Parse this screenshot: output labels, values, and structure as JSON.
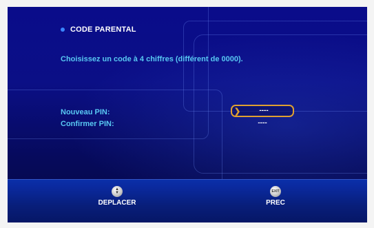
{
  "header": {
    "title": "CODE PARENTAL"
  },
  "instruction": "Choisissez un code à 4 chiffres (différent de 0000).",
  "form": {
    "new_pin_label": "Nouveau PIN:",
    "new_pin_value": "----",
    "confirm_pin_label": "Confirmer PIN:",
    "confirm_pin_value": "----"
  },
  "footer": {
    "move_label": "DEPLACER",
    "move_icon": "up-down-arrows-icon",
    "back_label": "PREC",
    "exit_icon_text": "EXIT"
  },
  "colors": {
    "accent_text": "#58c8f2",
    "focus_border": "#e0a030",
    "background": "#0a0c8a"
  }
}
